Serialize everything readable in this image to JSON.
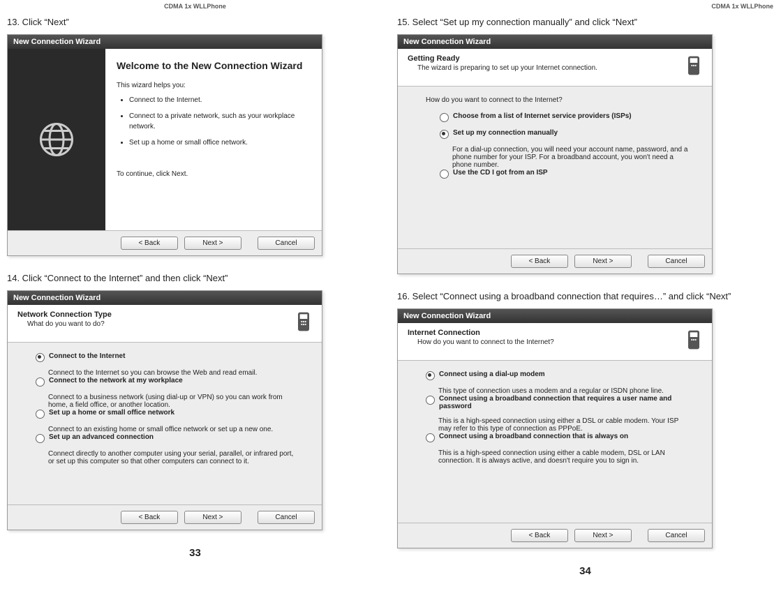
{
  "product_header": "CDMA 1x WLLPhone",
  "page_left_number": "33",
  "page_right_number": "34",
  "wizard_title": "New Connection Wizard",
  "buttons": {
    "back": "< Back",
    "next": "Next >",
    "cancel": "Cancel"
  },
  "step13": {
    "instruction": "13. Click “Next”",
    "welcome_heading": "Welcome to the New Connection Wizard",
    "helps_you": "This wizard helps you:",
    "bullets": [
      "Connect to the Internet.",
      "Connect to a private network, such as your workplace network.",
      "Set up a home or small office network."
    ],
    "continue_text": "To continue, click Next."
  },
  "step14": {
    "instruction": "14. Click “Connect to the Internet” and then click “Next”",
    "header_title": "Network Connection Type",
    "header_sub": "What do you want to do?",
    "options": [
      {
        "label": "Connect to the Internet",
        "desc": "Connect to the Internet so you can browse the Web and read email.",
        "selected": true
      },
      {
        "label": "Connect to the network at my workplace",
        "desc": "Connect to a business network (using dial-up or VPN) so you can work from home, a field office, or another location.",
        "selected": false
      },
      {
        "label": "Set up a home or small office network",
        "desc": "Connect to an existing home or small office network or set up a new one.",
        "selected": false
      },
      {
        "label": "Set up an advanced connection",
        "desc": "Connect directly to another computer using your serial, parallel, or infrared port, or set up this computer so that other computers can connect to it.",
        "selected": false
      }
    ]
  },
  "step15": {
    "instruction": "15. Select “Set up my connection manually” and click “Next”",
    "header_title": "Getting Ready",
    "header_sub": "The wizard is preparing to set up your Internet connection.",
    "question": "How do you want to connect to the Internet?",
    "options": [
      {
        "label": "Choose from a list of Internet service providers (ISPs)",
        "desc": "",
        "selected": false
      },
      {
        "label": "Set up my connection manually",
        "desc": "For a dial-up connection, you will need your account name, password, and a phone number for your ISP. For a broadband account, you won't need a phone number.",
        "selected": true
      },
      {
        "label": "Use the CD I got from an ISP",
        "desc": "",
        "selected": false
      }
    ]
  },
  "step16": {
    "instruction": "16. Select “Connect using a broadband connection that requires…” and click “Next”",
    "header_title": "Internet Connection",
    "header_sub": "How do you want to connect to the Internet?",
    "options": [
      {
        "label": "Connect using a dial-up modem",
        "desc": "This type of connection uses a modem and a regular or ISDN phone line.",
        "selected": true
      },
      {
        "label": "Connect using a broadband connection that requires a user name and password",
        "desc": "This is a high-speed connection using either a DSL or cable modem. Your ISP may refer to this type of connection as PPPoE.",
        "selected": false
      },
      {
        "label": "Connect using a broadband connection that is always on",
        "desc": "This is a high-speed connection using either a cable modem, DSL or LAN connection. It is always active, and doesn't require you to sign in.",
        "selected": false
      }
    ]
  }
}
